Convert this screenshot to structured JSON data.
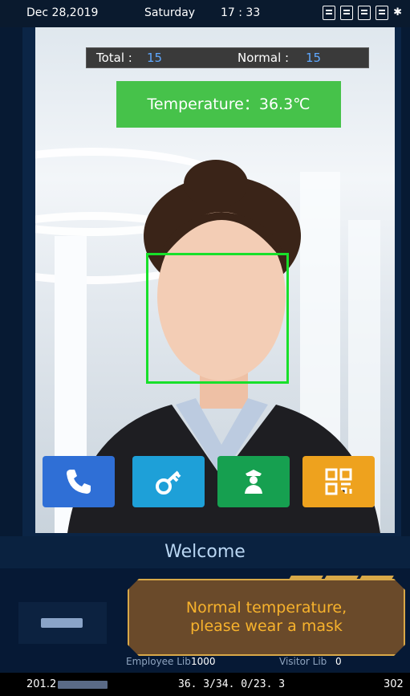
{
  "status": {
    "date": "Dec 28,2019",
    "weekday": "Saturday",
    "time": "17 : 33",
    "icons": [
      "face-icon",
      "id-card-icon",
      "card-lock-icon",
      "card-lock-icon",
      "bluetooth-icon"
    ],
    "bluetooth_glyph": "✱"
  },
  "counter": {
    "total_label": "Total :",
    "total_value": "15",
    "normal_label": "Normal :",
    "normal_value": "15"
  },
  "temperature": {
    "text": "Temperature：36.3℃"
  },
  "actions": [
    {
      "name": "call-button",
      "icon": "phone-icon",
      "color": "#2f6fd6"
    },
    {
      "name": "unlock-button",
      "icon": "key-icon",
      "color": "#1ea0d8"
    },
    {
      "name": "security-button",
      "icon": "guard-icon",
      "color": "#16a050"
    },
    {
      "name": "qr-code-button",
      "icon": "qr-code-icon",
      "color": "#eea21e"
    }
  ],
  "welcome": "Welcome",
  "notice": {
    "line1": "Normal temperature,",
    "line2": "please wear a mask"
  },
  "libs": {
    "employee_label": "Employee Lib",
    "employee_value": "1000",
    "visitor_label": "Visitor Lib",
    "visitor_value": "0"
  },
  "bottom": {
    "ip": "201.2",
    "temps": "36. 3/34. 0/23. 3",
    "code": "302"
  },
  "colors": {
    "temp_ok": "#46c24a",
    "face_frame": "#18e02a",
    "notice_text": "#f7b22c",
    "counter_value": "#5fa8ff"
  }
}
